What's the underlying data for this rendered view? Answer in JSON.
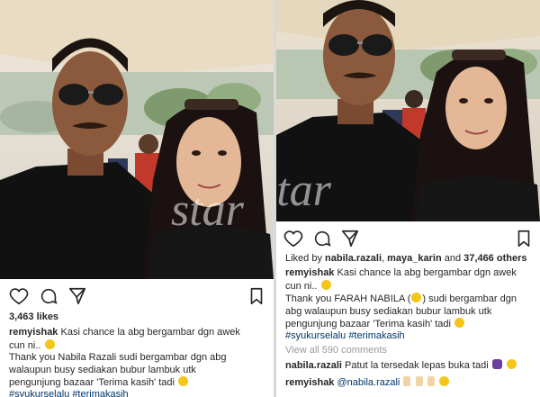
{
  "watermark": "star",
  "left_post": {
    "likes": "3,463 likes",
    "username": "remyishak",
    "caption_l1": "Kasi chance la abg bergambar dgn awek",
    "caption_l2": "cun ni..",
    "thanks_l1": "Thank you Nabila Razali sudi bergambar dgn abg",
    "thanks_l2": "walaupun busy sediakan bubur lambuk utk",
    "thanks_l3": "pengunjung bazaar 'Terima kasih' tadi",
    "hashtags": "#syukurselalu #terimakasih"
  },
  "right_post": {
    "liked_by_prefix": "Liked by ",
    "liked_user1": "nabila.razali",
    "liked_sep": ", ",
    "liked_user2": "maya_karin",
    "liked_and": " and ",
    "liked_count": "37,466 others",
    "username": "remyishak",
    "caption_l1": "Kasi chance la abg bergambar dgn awek",
    "caption_l2": "cun ni..",
    "thanks_l1": "Thank you FARAH NABILA (",
    "thanks_l1b": ") sudi bergambar dgn",
    "thanks_l2": "abg walaupun busy sediakan bubur lambuk utk",
    "thanks_l3": "pengunjung bazaar 'Terima kasih' tadi",
    "hashtags": "#syukurselalu #terimakasih",
    "view_comments": "View all 590 comments",
    "comment1_user": "nabila.razali",
    "comment1_text": "Patut la tersedak lepas buka tadi",
    "comment2_user": "remyishak",
    "comment2_mention": "@nabila.razali"
  },
  "icons": [
    "heart-icon",
    "comment-icon",
    "share-icon",
    "bookmark-icon"
  ]
}
